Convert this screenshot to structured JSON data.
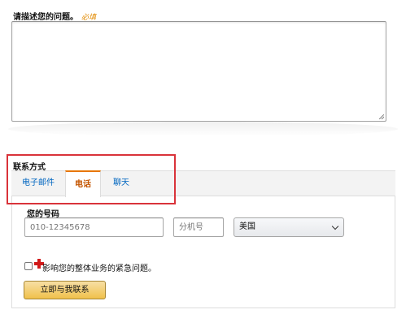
{
  "question": {
    "label": "请描述您的问题。",
    "required_tag": "必填",
    "textarea_value": ""
  },
  "contact": {
    "title": "联系方式",
    "tabs": [
      {
        "label": "电子邮件",
        "selected": false
      },
      {
        "label": "电话",
        "selected": true
      },
      {
        "label": "聊天",
        "selected": false
      }
    ],
    "phone_label": "您的号码",
    "phone_placeholder": "010-12345678",
    "phone_value": "",
    "extension_placeholder": "分机号",
    "extension_value": "",
    "country_selected": "美国",
    "urgent_checkbox_label": "影响您的整体业务的紧急问题。",
    "urgent_checked": false,
    "submit_button": "立即与我联系"
  },
  "colors": {
    "accent_orange": "#e77600",
    "link_blue": "#0066c0",
    "highlight_red": "#d9333a",
    "button_yellow": "#f0c14b",
    "urgent_red": "#d11a1a"
  },
  "icons": {
    "urgent": "red-cross-icon",
    "select": "chevron-down-icon",
    "textarea": "resize-grip-icon"
  }
}
